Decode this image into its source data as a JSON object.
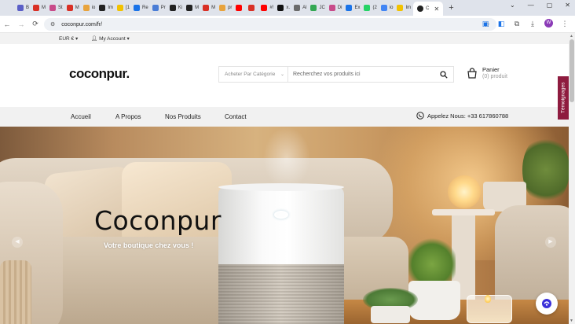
{
  "browser": {
    "tabs": [
      {
        "label": "B",
        "color": "#5b5fc7"
      },
      {
        "label": "M",
        "color": "#d93025"
      },
      {
        "label": "St",
        "color": "#c84b8a"
      },
      {
        "label": "M",
        "color": "#d93025"
      },
      {
        "label": "io",
        "color": "#e8a33d"
      },
      {
        "label": "Im",
        "color": "#222222"
      },
      {
        "label": "[1",
        "color": "#f2c200"
      },
      {
        "label": "Re",
        "color": "#1a73e8"
      },
      {
        "label": "Pr",
        "color": "#4a7dd6"
      },
      {
        "label": "Ki",
        "color": "#222222"
      },
      {
        "label": "M",
        "color": "#222222"
      },
      {
        "label": "M",
        "color": "#d93025"
      },
      {
        "label": "pr",
        "color": "#e8a33d"
      },
      {
        "label": "",
        "color": "#ff0000"
      },
      {
        "label": "",
        "color": "#d93025"
      },
      {
        "label": "#!",
        "color": "#ff0000"
      },
      {
        "label": "x.",
        "color": "#111111"
      },
      {
        "label": "Al",
        "color": "#6b6b6b"
      },
      {
        "label": "JC",
        "color": "#34a853"
      },
      {
        "label": "Di",
        "color": "#c84b8a"
      },
      {
        "label": "Ex",
        "color": "#1a73e8"
      },
      {
        "label": "(2",
        "color": "#25d366"
      },
      {
        "label": "io",
        "color": "#4285f4"
      },
      {
        "label": "Im",
        "color": "#f2c200"
      }
    ],
    "active_tab_label": "C",
    "url": "coconpur.com/fr/",
    "profile_initial": "W"
  },
  "topbar": {
    "currency": "EUR €",
    "account": "My Account"
  },
  "header": {
    "logo": "coconpur",
    "logo_dot": ".",
    "category_placeholder": "Acheter Par Catégorie",
    "search_placeholder": "Recherchez vos produits ici",
    "cart_title": "Panier",
    "cart_count": "(0) produit"
  },
  "nav": {
    "items": [
      "Accueil",
      "A Propos",
      "Nos Produits",
      "Contact"
    ],
    "phone": "Appelez Nous: +33 617860788"
  },
  "side_tab": "Témoignages",
  "hero": {
    "title": "Coconpur",
    "subtitle": "Votre boutique chez vous !"
  },
  "colors": {
    "accent_side_tab": "#8e1b3f",
    "nav_bg": "#f1f1f1"
  }
}
